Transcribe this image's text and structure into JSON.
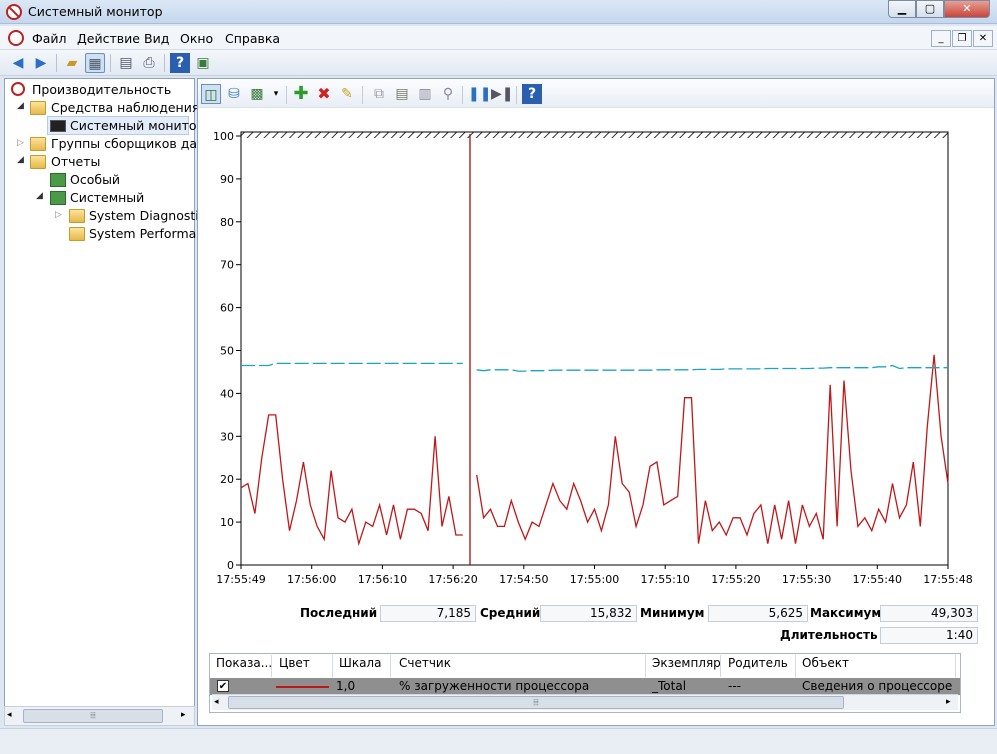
{
  "window": {
    "title": "Системный монитор"
  },
  "menu": [
    "Файл",
    "Действие",
    "Вид",
    "Окно",
    "Справка"
  ],
  "tree": {
    "root": "Производительность",
    "monitoring_tools": "Средства наблюдения",
    "system_monitor": "Системный монитор",
    "collector_sets": "Группы сборщиков данн",
    "reports": "Отчеты",
    "user_defined": "Особый",
    "system": "Системный",
    "system_diagnostics": "System Diagnostics",
    "system_performance": "System Performanc"
  },
  "chart_data": {
    "type": "line",
    "ylim": [
      0,
      100
    ],
    "yticks": [
      "100",
      "90",
      "80",
      "70",
      "60",
      "50",
      "40",
      "30",
      "20",
      "10",
      "0"
    ],
    "xticks": [
      "17:55:49",
      "17:56:00",
      "17:56:10",
      "17:56:20",
      "17:54:50",
      "17:55:00",
      "17:55:10",
      "17:55:20",
      "17:55:30",
      "17:55:40",
      "17:55:48"
    ],
    "series": [
      {
        "color": "#c01818",
        "values": [
          18,
          19,
          12,
          25,
          35,
          35,
          20,
          8,
          15,
          24,
          14,
          9,
          6,
          22,
          11,
          10,
          13,
          5,
          10,
          9,
          14,
          7,
          14,
          6,
          13,
          13,
          12,
          8,
          30,
          9,
          16,
          7,
          7,
          null,
          21,
          11,
          13,
          9,
          9,
          15,
          10,
          6,
          10,
          9,
          14,
          19,
          15,
          13,
          19,
          15,
          10,
          13,
          8,
          14,
          30,
          19,
          17,
          9,
          14,
          23,
          24,
          14,
          15,
          16,
          39,
          39,
          5,
          15,
          8,
          10,
          7,
          11,
          11,
          7,
          12,
          14,
          5,
          14,
          6,
          15,
          5,
          14,
          9,
          12,
          6,
          42,
          9,
          43,
          22,
          9,
          11,
          8,
          13,
          10,
          19,
          11,
          14,
          24,
          9,
          32,
          49,
          30,
          19
        ]
      },
      {
        "color": "#1aa3c8",
        "dashed": true,
        "values": [
          46.5,
          46.5,
          46.5,
          46.5,
          46.5,
          47,
          47,
          47,
          47,
          47,
          47,
          47,
          47,
          47,
          47,
          47,
          47,
          47,
          47,
          47,
          47,
          47,
          47,
          47,
          47,
          47,
          47,
          47,
          47,
          47,
          47,
          47,
          47,
          null,
          45.5,
          45.3,
          45.5,
          45.5,
          45.5,
          45.5,
          45.2,
          45.2,
          45.3,
          45.3,
          45.3,
          45.4,
          45.4,
          45.4,
          45.4,
          45.4,
          45.4,
          45.4,
          45.4,
          45.4,
          45.4,
          45.4,
          45.4,
          45.4,
          45.4,
          45.4,
          45.5,
          45.5,
          45.5,
          45.5,
          45.5,
          45.5,
          45.6,
          45.6,
          45.6,
          45.6,
          45.7,
          45.7,
          45.7,
          45.7,
          45.7,
          45.7,
          45.8,
          45.8,
          45.8,
          45.8,
          45.8,
          45.8,
          45.8,
          45.9,
          45.9,
          46,
          46,
          46,
          46,
          46,
          46,
          46,
          46.2,
          46.2,
          46.5,
          45.8,
          46,
          46,
          46,
          46,
          46,
          46,
          46
        ]
      }
    ]
  },
  "stats": {
    "last_label": "Последний",
    "last_value": "7,185",
    "avg_label": "Средний",
    "avg_value": "15,832",
    "min_label": "Минимум",
    "min_value": "5,625",
    "max_label": "Максимум",
    "max_value": "49,303",
    "duration_label": "Длительность",
    "duration_value": "1:40"
  },
  "legend": {
    "columns": [
      "Показа...",
      "Цвет",
      "Шкала",
      "Счетчик",
      "Экземпляр",
      "Родитель",
      "Объект"
    ],
    "row": {
      "scale": "1,0",
      "counter": "% загруженности процессора",
      "instance": "_Total",
      "parent": "---",
      "object": "Сведения о процессоре"
    }
  }
}
